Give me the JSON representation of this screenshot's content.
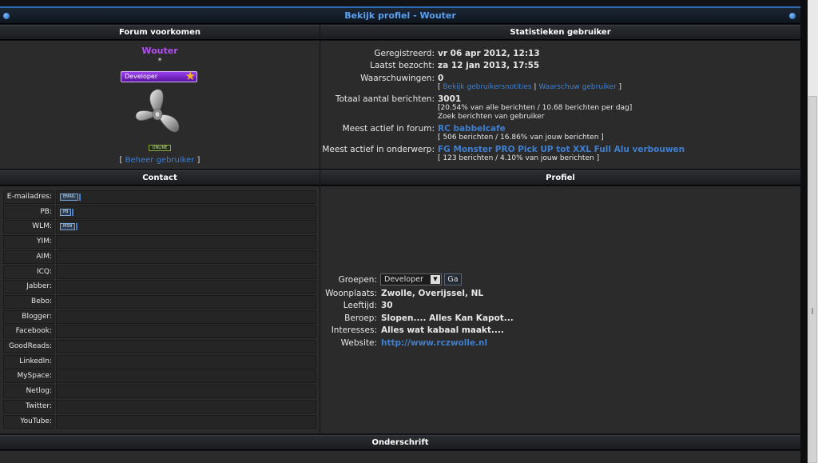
{
  "title": "Bekijk profiel - Wouter",
  "left": {
    "header": "Forum voorkomen",
    "username": "Wouter",
    "star": "*",
    "rank": "Developer",
    "online": "ONLINE",
    "beheer_open": "[",
    "beheer_link": "Beheer gebruiker",
    "beheer_close": "]"
  },
  "stats": {
    "header": "Statistieken gebruiker",
    "registered_label": "Geregistreerd:",
    "registered_value": "vr 06 apr 2012, 12:13",
    "visited_label": "Laatst bezocht:",
    "visited_value": "za 12 jan 2013, 17:55",
    "warnings_label": "Waarschuwingen:",
    "warnings_value": "0",
    "notes_link": "Bekijk gebruikersnotities",
    "warn_link": "Waarschuw gebruiker",
    "total_label": "Totaal aantal berichten:",
    "total_value": "3001",
    "total_sub": "[20.54% van alle berichten / 10.68 berichten per dag]",
    "search_link": "Zoek berichten van gebruiker",
    "forum_label": "Meest actief in forum:",
    "forum_value": "RC babbelcafe",
    "forum_sub": "[ 506 berichten / 16.86% van jouw berichten ]",
    "topic_label": "Meest actief in onderwerp:",
    "topic_value": "FG Monster PRO Pick UP tot XXL Full Alu verbouwen",
    "topic_sub": "[ 123 berichten / 4.10% van jouw berichten ]"
  },
  "contact": {
    "header": "Contact",
    "rows": [
      {
        "label": "E-mailadres:",
        "badge": "EMAIL"
      },
      {
        "label": "PB:",
        "badge": "PB"
      },
      {
        "label": "WLM:",
        "badge": "MSN"
      },
      {
        "label": "YIM:",
        "badge": ""
      },
      {
        "label": "AIM:",
        "badge": ""
      },
      {
        "label": "ICQ:",
        "badge": ""
      },
      {
        "label": "Jabber:",
        "badge": ""
      },
      {
        "label": "Bebo:",
        "badge": ""
      },
      {
        "label": "Blogger:",
        "badge": ""
      },
      {
        "label": "Facebook:",
        "badge": ""
      },
      {
        "label": "GoodReads:",
        "badge": ""
      },
      {
        "label": "LinkedIn:",
        "badge": ""
      },
      {
        "label": "MySpace:",
        "badge": ""
      },
      {
        "label": "Netlog:",
        "badge": ""
      },
      {
        "label": "Twitter:",
        "badge": ""
      },
      {
        "label": "YouTube:",
        "badge": ""
      }
    ]
  },
  "profile": {
    "header": "Profiel",
    "groups_label": "Groepen:",
    "groups_selected": "Developer",
    "go_label": "Ga",
    "location_label": "Woonplaats:",
    "location_value": "Zwolle, Overijssel, NL",
    "age_label": "Leeftijd:",
    "age_value": "30",
    "job_label": "Beroep:",
    "job_value": "Slopen.... Alles Kan Kapot...",
    "interests_label": "Interesses:",
    "interests_value": "Alles wat kabaal maakt....",
    "website_label": "Website:",
    "website_value": "http://www.rczwolle.nl"
  },
  "signature_header": "Onderschrift"
}
